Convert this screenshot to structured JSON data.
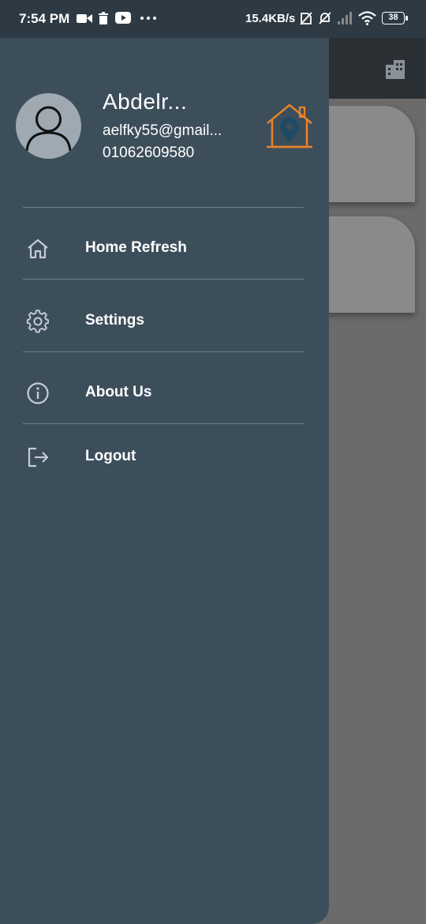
{
  "status_bar": {
    "time": "7:54 PM",
    "network_speed": "15.4KB/s",
    "battery_level": "38",
    "icons": [
      "video-camera-icon",
      "trash-icon",
      "youtube-icon",
      "more-dots-icon",
      "no-sim-icon",
      "bell-off-icon",
      "signal-icon",
      "wifi-icon",
      "battery-icon"
    ]
  },
  "drawer": {
    "user": {
      "name": "Abdelr...",
      "email": "aelfky55@gmail...",
      "phone": "01062609580"
    },
    "logo_icon": "house-location-logo",
    "menu": [
      {
        "label": "Home Refresh",
        "icon": "home-icon"
      },
      {
        "label": "Settings",
        "icon": "gear-icon"
      },
      {
        "label": "About Us",
        "icon": "info-icon"
      },
      {
        "label": "Logout",
        "icon": "logout-icon"
      }
    ]
  },
  "colors": {
    "drawer_bg": "#3d4e5b",
    "status_bar_bg": "#2e3a43",
    "logo_orange": "#e8832a",
    "logo_pin": "#1f4a66",
    "scrim": "#6b6b6b"
  }
}
